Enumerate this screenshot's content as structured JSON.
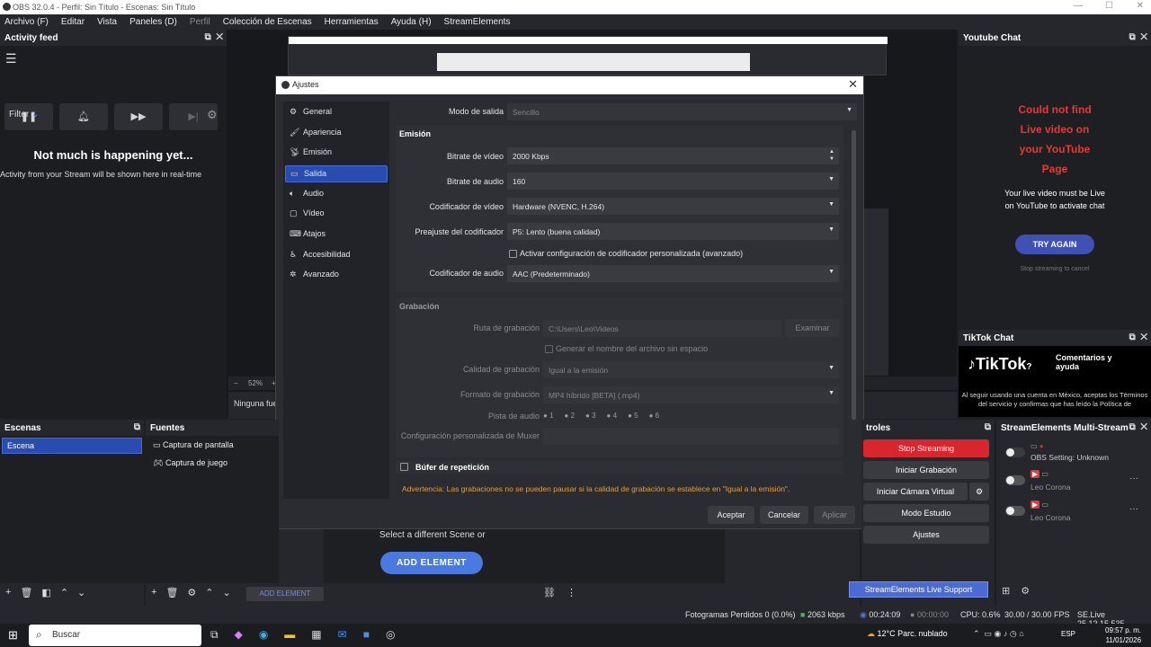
{
  "window": {
    "title": "OBS 32.0.4 - Perfil: Sin Título - Escenas: Sin Título"
  },
  "menu": {
    "items": [
      "Archivo (F)",
      "Editar",
      "Vista",
      "Paneles (D)",
      "Perfil",
      "Colección de Escenas",
      "Herramientas",
      "Ayuda (H)",
      "StreamElements"
    ]
  },
  "activity": {
    "title": "Activity feed",
    "filter": "Filter",
    "heading": "Not much is happening yet...",
    "sub": "Activity from your Stream will be shown here in real-time",
    "buttons": [
      "pause-icon",
      "bell-icon",
      "skip-icon",
      "skip-end-icon"
    ]
  },
  "dialog": {
    "title": "Ajustes",
    "nav": [
      {
        "label": "General",
        "icon": "gear-icon"
      },
      {
        "label": "Apariencia",
        "icon": "paint-icon"
      },
      {
        "label": "Emisión",
        "icon": "antenna-icon"
      },
      {
        "label": "Salida",
        "icon": "output-icon",
        "selected": true
      },
      {
        "label": "Audio",
        "icon": "speaker-icon"
      },
      {
        "label": "Vídeo",
        "icon": "monitor-icon"
      },
      {
        "label": "Atajos",
        "icon": "keyboard-icon"
      },
      {
        "label": "Accesibilidad",
        "icon": "accessibility-icon"
      },
      {
        "label": "Avanzado",
        "icon": "wrench-icon"
      }
    ],
    "mode_label": "Modo de salida",
    "mode_value": "Sencillo",
    "emision": {
      "title": "Emisión",
      "video_bitrate_label": "Bitrate de vídeo",
      "video_bitrate": "2000 Kbps",
      "audio_bitrate_label": "Bitrate de audio",
      "audio_bitrate": "160",
      "video_encoder_label": "Codificador de vídeo",
      "video_encoder": "Hardware (NVENC, H.264)",
      "preset_label": "Preajuste del codificador",
      "preset": "P5: Lento (buena calidad)",
      "custom_enc": "Activar configuración de codificador personalizada (avanzado)",
      "audio_encoder_label": "Codificador de audio",
      "audio_encoder": "AAC (Predeterminado)"
    },
    "grabacion": {
      "title": "Grabación",
      "path_label": "Ruta de grabación",
      "path": "C:\\Users\\Leo\\Videos",
      "browse": "Examinar",
      "nospace": "Generar el nombre del archivo sin espacio",
      "quality_label": "Calidad de grabación",
      "quality": "Igual a la emisión",
      "format_label": "Formato de grabación",
      "format": "MP4 híbrido [BETA] (.mp4)",
      "tracks_label": "Pista de audio",
      "tracks": [
        "1",
        "2",
        "3",
        "4",
        "5",
        "6"
      ],
      "muxer_label": "Configuración personalizada de Muxer"
    },
    "replay": "Búfer de repetición",
    "warning": "Advertencia: Las grabaciones no se pueden pausar si la calidad de grabación se establece en \"Igual a la emisión\".",
    "buttons": {
      "ok": "Aceptar",
      "cancel": "Cancelar",
      "apply": "Aplicar"
    }
  },
  "preview": {
    "zoom": "52%",
    "no_source": "Ninguna fue",
    "select_scene": "Select a different Scene or",
    "add_element": "ADD ELEMENT",
    "add_element_small": "ADD ELEMENT"
  },
  "youtube": {
    "title": "Youtube Chat",
    "error": "Could not find Live video on your YouTube Page",
    "info": "Your live video must be Live on YouTube to activate chat",
    "try": "TRY AGAIN",
    "stop": "Stop streaming to cancel"
  },
  "tiktok": {
    "title": "TikTok Chat",
    "logo": "TikTok",
    "tag": "Comentarios y ayuda",
    "notice": "Al seguir usando una cuenta en México, aceptas los Términos del servicio y confirmas que has leído la Política de"
  },
  "scenes": {
    "title": "Escenas",
    "items": [
      "Escena"
    ]
  },
  "sources": {
    "title": "Fuentes",
    "items": [
      {
        "label": "Captura de pantalla",
        "icon": "monitor-icon"
      },
      {
        "label": "Captura de juego",
        "icon": "gamepad-icon"
      }
    ]
  },
  "controls": {
    "title": "troles",
    "stop": "Stop Streaming",
    "record": "Iniciar Grabación",
    "vcam": "Iniciar Cámara Virtual",
    "studio": "Modo Estudio",
    "settings": "Ajustes",
    "support": "StreamElements Live Support"
  },
  "se": {
    "title": "StreamElements Multi-Stream",
    "rows": [
      {
        "name": "OBS Setting: Unknown"
      },
      {
        "name": "Leo Corona"
      },
      {
        "name": "Leo Corona"
      }
    ]
  },
  "status": {
    "dropped": "Fotogramas Perdidos 0 (0.0%)",
    "kbps": "2063 kbps",
    "live": "00:24:09",
    "rec": "00:00:00",
    "cpu": "CPU: 0.6%",
    "fps": "30.00 / 30.00 FPS",
    "version": "SE.Live 25.12.15.535"
  },
  "taskbar": {
    "search": "Buscar",
    "weather": "12°C  Parc. nublado",
    "lang": "ESP",
    "time": "09:57 p. m.",
    "date": "11/01/2026"
  },
  "colors": {
    "accent": "#284cb0",
    "live_red": "#d9252e",
    "warning": "#e0a040",
    "error_red": "#e53935",
    "try_btn": "#3f51b5",
    "add_btn": "#4a7ae0"
  }
}
